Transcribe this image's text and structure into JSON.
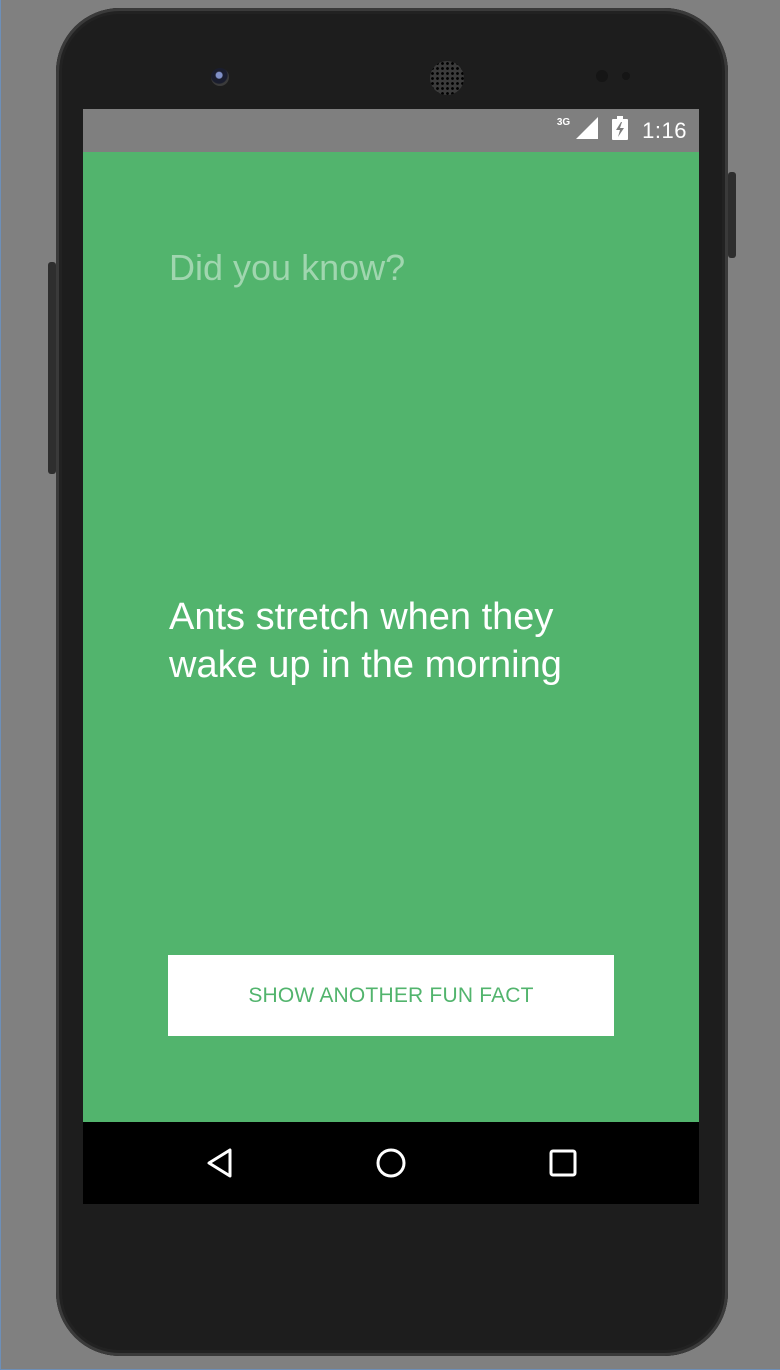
{
  "status_bar": {
    "network": "3G",
    "time": "1:16",
    "icons": [
      "signal-icon",
      "battery-icon"
    ]
  },
  "app": {
    "heading": "Did you know?",
    "fact": "Ants stretch when they wake up in the morning",
    "button_label": "SHOW ANOTHER FUN FACT",
    "background_color": "#52b46d"
  },
  "nav_bar": {
    "icons": [
      "back-icon",
      "home-icon",
      "recents-icon"
    ]
  }
}
